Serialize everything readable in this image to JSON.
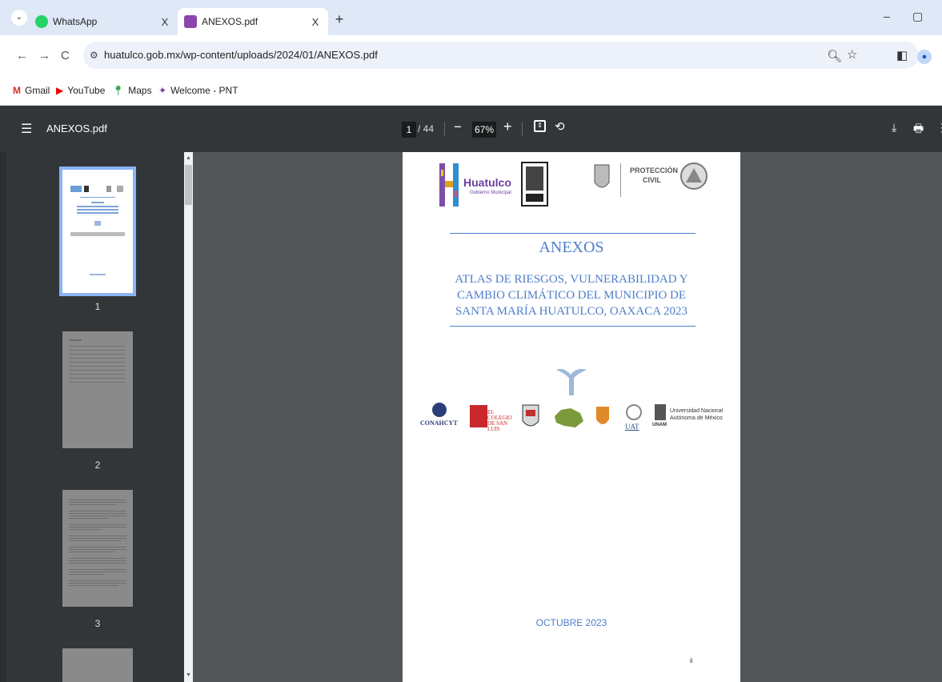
{
  "tabs": [
    {
      "title": "WhatsApp",
      "close": "X"
    },
    {
      "title": "ANEXOS.pdf",
      "close": "X"
    }
  ],
  "new_tab": "+",
  "address": {
    "url": "huatulco.gob.mx/wp-content/uploads/2024/01/ANEXOS.pdf"
  },
  "bookmarks": [
    "Gmail",
    "YouTube",
    "Maps",
    "Welcome - PNT"
  ],
  "pdf_toolbar": {
    "filename": "ANEXOS.pdf",
    "current_page": "1",
    "total_pages": "/ 44",
    "zoom": "67%"
  },
  "thumbnails": [
    "1",
    "2",
    "3"
  ],
  "document": {
    "heading": "ANEXOS",
    "subtitle_lines": [
      "ATLAS DE RIESGOS, VULNERABILIDAD Y",
      "CAMBIO CLIMÁTICO DEL MUNICIPIO DE",
      "SANTA MARÍA HUATULCO, OAXACA 2023"
    ],
    "date": "OCTUBRE 2023",
    "page_footer": "ii",
    "logo_huatulco": "Huatulco",
    "logo_huatulco_sub": "Gobierno Municipal",
    "logo_proteccion_1": "PROTECCIÓN",
    "logo_proteccion_2": "CIVIL",
    "logo_conahcyt": "CONAHCYT",
    "logo_colegio": "EL COLEGIO DE SAN LUIS",
    "logo_unam_1": "Universidad Nacional",
    "logo_unam_2": "Autónoma de México",
    "logo_unam_short": "UNAM",
    "logo_uat": "UAT"
  },
  "colors": {
    "accent_blue": "#4f7ec9",
    "pdf_toolbar": "#323639",
    "viewer_bg": "#525659",
    "tab_strip": "#dfe8f7"
  }
}
